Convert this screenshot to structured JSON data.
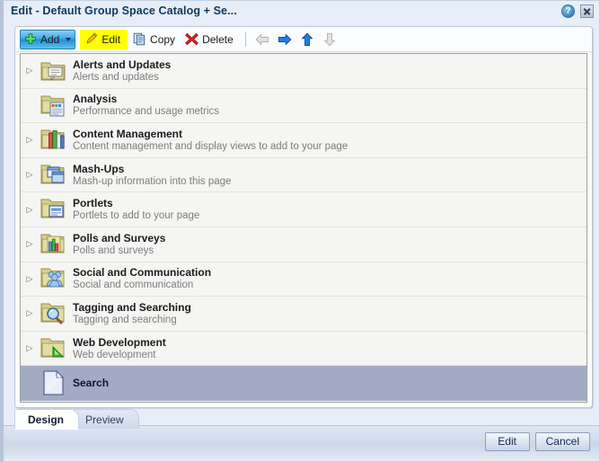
{
  "window": {
    "title": "Edit - Default Group Space Catalog + Se...",
    "help_icon": "help-icon",
    "help_label": "?",
    "close_icon": "close-icon"
  },
  "toolbar": {
    "add_label": "Add",
    "add_icon": "plus-icon",
    "add_dropdown_icon": "chevron-down-icon",
    "edit_label": "Edit",
    "edit_icon": "pencil-icon",
    "copy_label": "Copy",
    "copy_icon": "copy-icon",
    "delete_label": "Delete",
    "delete_icon": "delete-x-icon",
    "nav": [
      {
        "name": "move-left-arrow",
        "direction": "left",
        "enabled": false
      },
      {
        "name": "move-right-arrow",
        "direction": "right",
        "enabled": true
      },
      {
        "name": "move-up-arrow",
        "direction": "up",
        "enabled": true
      },
      {
        "name": "move-down-arrow",
        "direction": "down",
        "enabled": false
      }
    ]
  },
  "list": {
    "rows": [
      {
        "title": "Alerts and Updates",
        "description": "Alerts and updates",
        "icon": "folder-alerts-icon",
        "expandable": true,
        "selected": false
      },
      {
        "title": "Analysis",
        "description": "Performance and usage metrics",
        "icon": "folder-analysis-icon",
        "expandable": false,
        "selected": false
      },
      {
        "title": "Content Management",
        "description": "Content management and display views to add to your page",
        "icon": "folder-content-icon",
        "expandable": true,
        "selected": false
      },
      {
        "title": "Mash-Ups",
        "description": "Mash-up information into this page",
        "icon": "folder-mashup-icon",
        "expandable": true,
        "selected": false
      },
      {
        "title": "Portlets",
        "description": "Portlets to add to your page",
        "icon": "folder-portlets-icon",
        "expandable": true,
        "selected": false
      },
      {
        "title": "Polls and Surveys",
        "description": "Polls and surveys",
        "icon": "folder-polls-icon",
        "expandable": true,
        "selected": false
      },
      {
        "title": "Social and Communication",
        "description": "Social and communication",
        "icon": "folder-social-icon",
        "expandable": true,
        "selected": false
      },
      {
        "title": "Tagging and Searching",
        "description": "Tagging and searching",
        "icon": "folder-tagging-icon",
        "expandable": true,
        "selected": false
      },
      {
        "title": "Web Development",
        "description": "Web development",
        "icon": "folder-webdev-icon",
        "expandable": true,
        "selected": false
      },
      {
        "title": "Search",
        "description": "",
        "icon": "document-icon",
        "expandable": false,
        "selected": true
      }
    ]
  },
  "tabs": [
    {
      "label": "Design",
      "active": true
    },
    {
      "label": "Preview",
      "active": false
    }
  ],
  "footer": {
    "edit_label": "Edit",
    "cancel_label": "Cancel"
  },
  "colors": {
    "accent_blue": "#1f8fd8",
    "highlight_yellow": "#ffff00",
    "selection": "#a3aac4",
    "title_text": "#0d3a5c"
  }
}
